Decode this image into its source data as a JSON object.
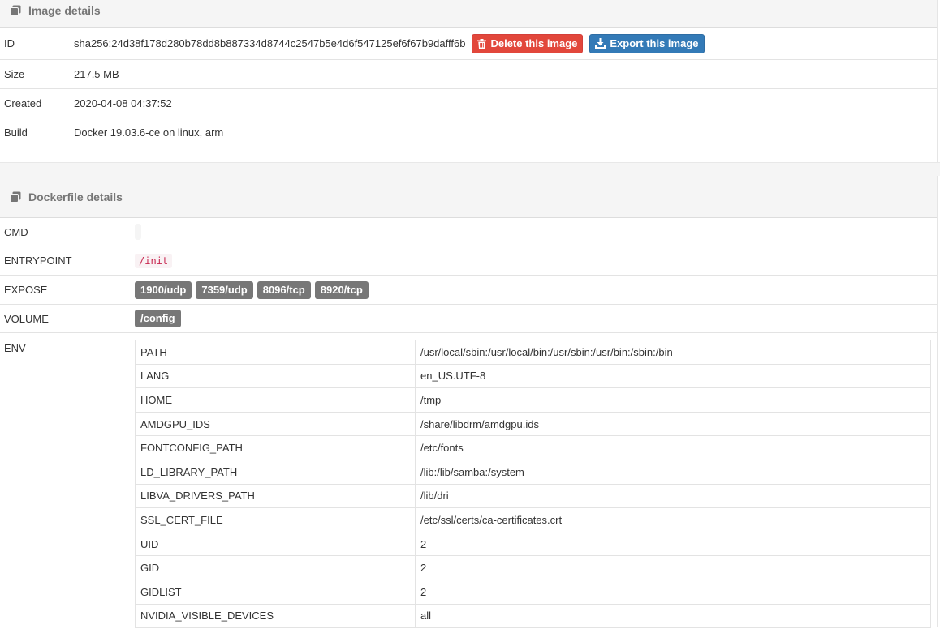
{
  "image_details": {
    "title": "Image details",
    "id_label": "ID",
    "id_value": "sha256:24d38f178d280b78dd8b887334d8744c2547b5e4d6f547125ef6f67b9dafff6b",
    "delete_label": "Delete this image",
    "export_label": "Export this image",
    "size_label": "Size",
    "size_value": "217.5 MB",
    "created_label": "Created",
    "created_value": "2020-04-08 04:37:52",
    "build_label": "Build",
    "build_value": "Docker 19.03.6-ce on linux, arm"
  },
  "dockerfile": {
    "title": "Dockerfile details",
    "cmd_label": "CMD",
    "entrypoint_label": "ENTRYPOINT",
    "entrypoint_value": "/init",
    "expose_label": "EXPOSE",
    "ports": [
      "1900/udp",
      "7359/udp",
      "8096/tcp",
      "8920/tcp"
    ],
    "volume_label": "VOLUME",
    "volume_value": "/config",
    "env_label": "ENV",
    "env": [
      {
        "key": "PATH",
        "value": "/usr/local/sbin:/usr/local/bin:/usr/sbin:/usr/bin:/sbin:/bin"
      },
      {
        "key": "LANG",
        "value": "en_US.UTF-8"
      },
      {
        "key": "HOME",
        "value": "/tmp"
      },
      {
        "key": "AMDGPU_IDS",
        "value": "/share/libdrm/amdgpu.ids"
      },
      {
        "key": "FONTCONFIG_PATH",
        "value": "/etc/fonts"
      },
      {
        "key": "LD_LIBRARY_PATH",
        "value": "/lib:/lib/samba:/system"
      },
      {
        "key": "LIBVA_DRIVERS_PATH",
        "value": "/lib/dri"
      },
      {
        "key": "SSL_CERT_FILE",
        "value": "/etc/ssl/certs/ca-certificates.crt"
      },
      {
        "key": "UID",
        "value": "2"
      },
      {
        "key": "GID",
        "value": "2"
      },
      {
        "key": "GIDLIST",
        "value": "2"
      },
      {
        "key": "NVIDIA_VISIBLE_DEVICES",
        "value": "all"
      }
    ]
  },
  "colors": {
    "danger": "#e2473b",
    "primary": "#337ab7",
    "badge": "#777777",
    "code_text": "#c7254e"
  }
}
